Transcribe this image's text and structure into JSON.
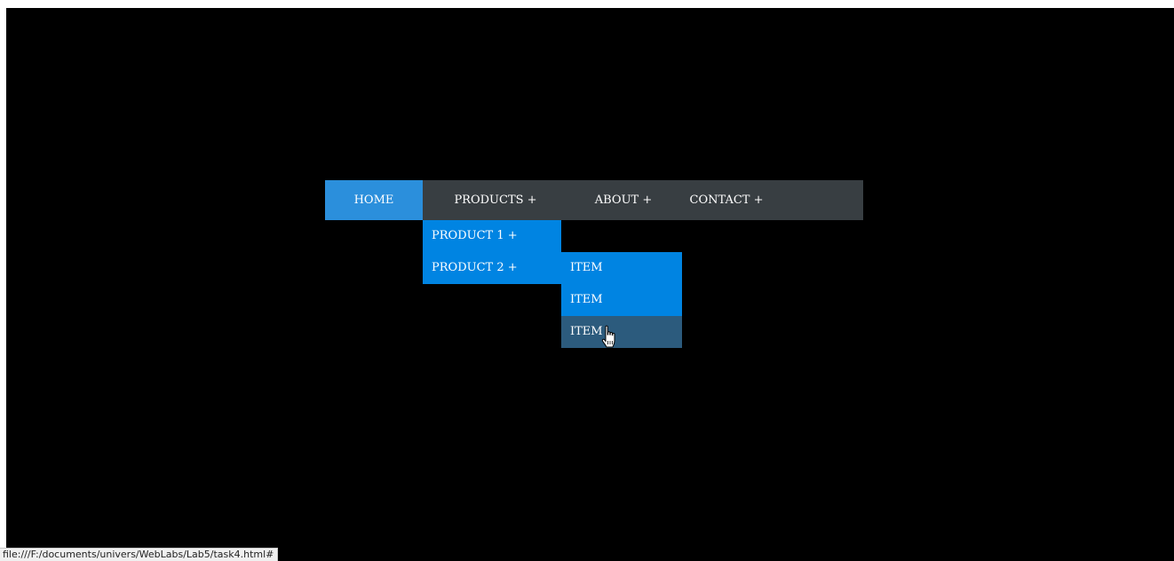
{
  "colors": {
    "page_background": "#000000",
    "navbar_background": "#383e42",
    "active_item": "#2b8fdc",
    "dropdown_background": "#0084e2",
    "dropdown_hover": "#2c5b7d",
    "text": "#ffffff"
  },
  "nav": {
    "items": [
      {
        "label": "HOME",
        "active": true
      },
      {
        "label": "PRODUCTS +"
      },
      {
        "label": "ABOUT +"
      },
      {
        "label": "CONTACT +"
      }
    ]
  },
  "products_menu": {
    "items": [
      {
        "label": "PRODUCT 1 +"
      },
      {
        "label": "PRODUCT 2 +"
      }
    ]
  },
  "product2_menu": {
    "items": [
      {
        "label": "ITEM"
      },
      {
        "label": "ITEM"
      },
      {
        "label": "ITEM",
        "hovered": true
      }
    ]
  },
  "cursor": {
    "icon": "hand-pointer-icon"
  },
  "status_bar": {
    "url": "file:///F:/documents/univers/WebLabs/Lab5/task4.html#"
  }
}
